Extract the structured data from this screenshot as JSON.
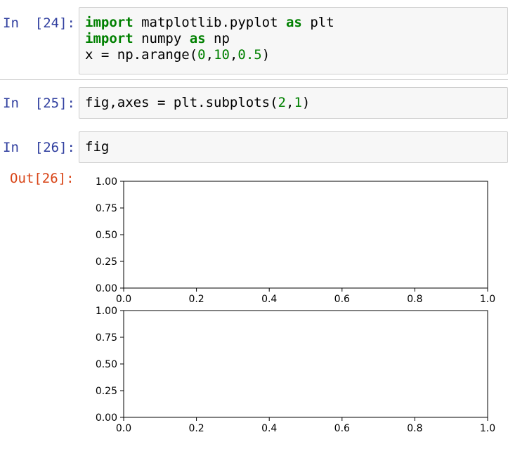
{
  "cells": [
    {
      "prompt": "In  [24]:",
      "lines": [
        [
          {
            "t": "import",
            "c": "kw"
          },
          {
            "t": " matplotlib.pyplot ",
            "c": ""
          },
          {
            "t": "as",
            "c": "kw"
          },
          {
            "t": " plt",
            "c": ""
          }
        ],
        [
          {
            "t": "import",
            "c": "kw"
          },
          {
            "t": " numpy ",
            "c": ""
          },
          {
            "t": "as",
            "c": "kw"
          },
          {
            "t": " np",
            "c": ""
          }
        ],
        [
          {
            "t": "x = np.arange(",
            "c": ""
          },
          {
            "t": "0",
            "c": "num"
          },
          {
            "t": ",",
            "c": ""
          },
          {
            "t": "10",
            "c": "num"
          },
          {
            "t": ",",
            "c": ""
          },
          {
            "t": "0.5",
            "c": "num"
          },
          {
            "t": ")",
            "c": ""
          }
        ]
      ]
    },
    {
      "prompt": "In  [25]:",
      "lines": [
        [
          {
            "t": "fig,axes = plt.subplots(",
            "c": ""
          },
          {
            "t": "2",
            "c": "num"
          },
          {
            "t": ",",
            "c": ""
          },
          {
            "t": "1",
            "c": "num"
          },
          {
            "t": ")",
            "c": ""
          }
        ]
      ]
    },
    {
      "prompt": "In  [26]:",
      "lines": [
        [
          {
            "t": "fig",
            "c": ""
          }
        ]
      ]
    }
  ],
  "output": {
    "prompt": "Out[26]:"
  },
  "chart_data": [
    {
      "type": "line",
      "series": [],
      "xlim": [
        0.0,
        1.0
      ],
      "ylim": [
        0.0,
        1.0
      ],
      "xticks": [
        "0.0",
        "0.2",
        "0.4",
        "0.6",
        "0.8",
        "1.0"
      ],
      "yticks": [
        "0.00",
        "0.25",
        "0.50",
        "0.75",
        "1.00"
      ],
      "grid": false
    },
    {
      "type": "line",
      "series": [],
      "xlim": [
        0.0,
        1.0
      ],
      "ylim": [
        0.0,
        1.0
      ],
      "xticks": [
        "0.0",
        "0.2",
        "0.4",
        "0.6",
        "0.8",
        "1.0"
      ],
      "yticks": [
        "0.00",
        "0.25",
        "0.50",
        "0.75",
        "1.00"
      ],
      "grid": false
    }
  ]
}
